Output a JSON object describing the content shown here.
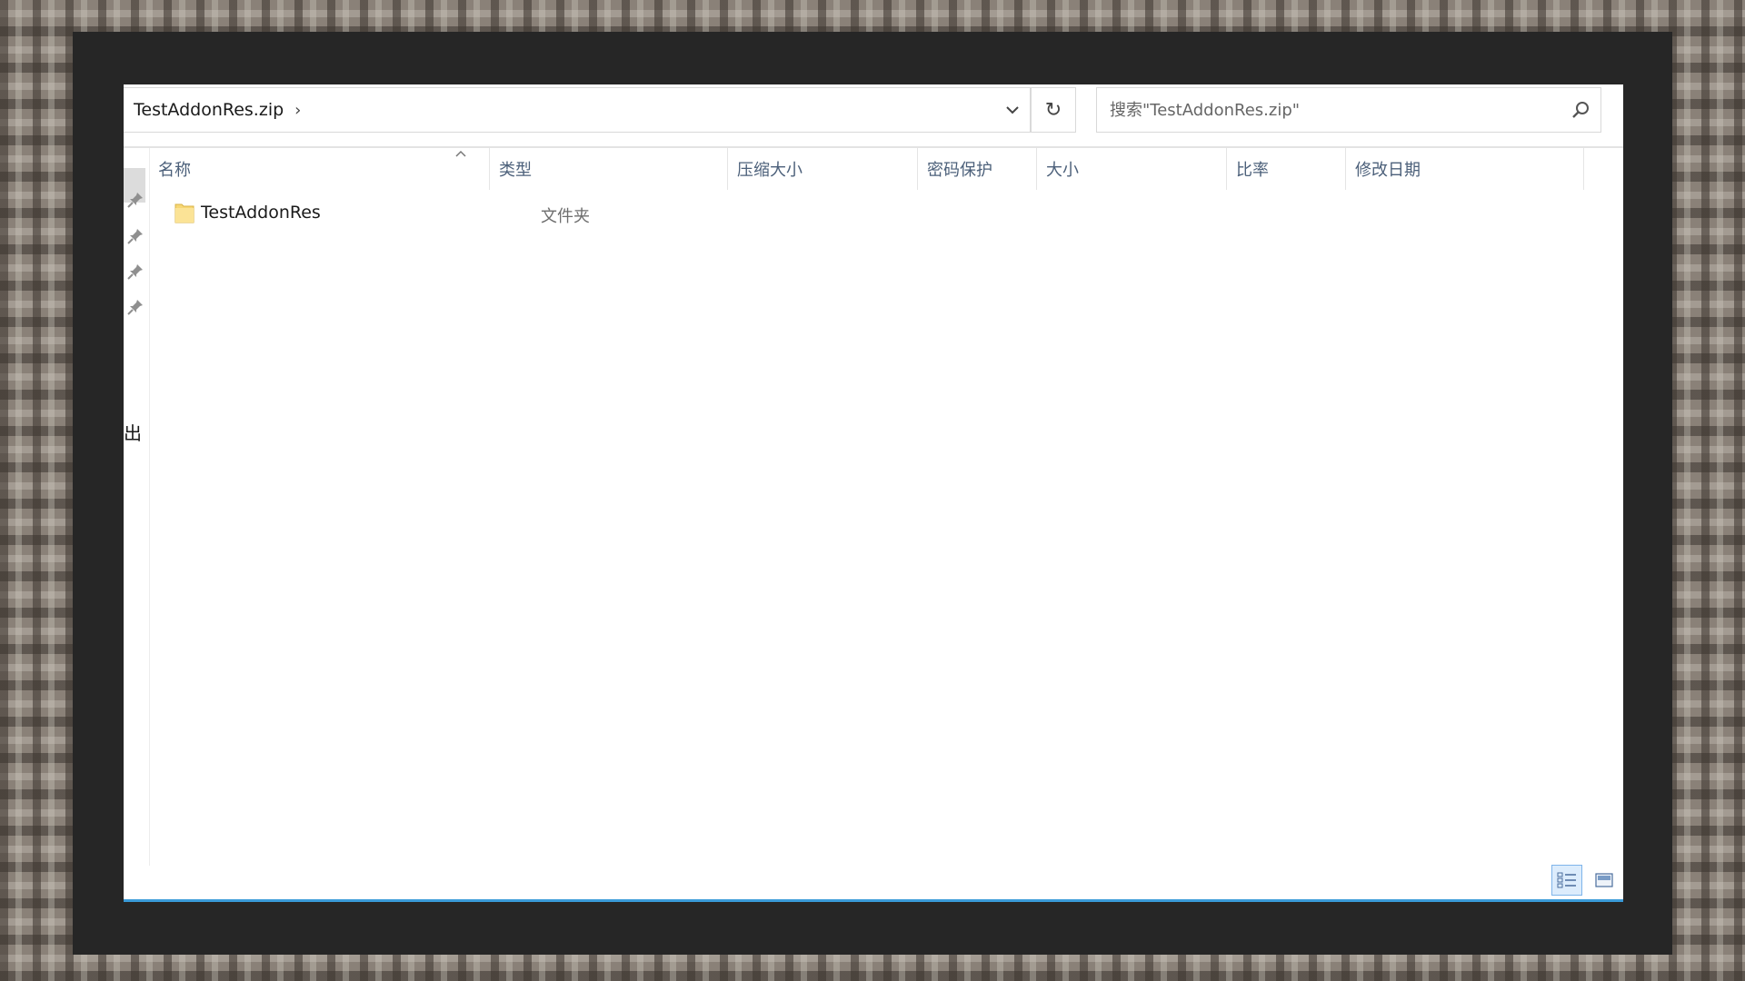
{
  "toolbar": {
    "breadcrumb": {
      "root": "TestAddonRes.zip",
      "separator": "›"
    },
    "refresh_glyph": "↻",
    "search": {
      "placeholder": "搜索\"TestAddonRes.zip\""
    }
  },
  "nav_pane": {
    "label": "出"
  },
  "columns": [
    {
      "label": "名称"
    },
    {
      "label": "类型"
    },
    {
      "label": "压缩大小"
    },
    {
      "label": "密码保护"
    },
    {
      "label": "大小"
    },
    {
      "label": "比率"
    },
    {
      "label": "修改日期"
    }
  ],
  "files": [
    {
      "name": "TestAddonRes",
      "type": "文件夹",
      "icon": "folder-icon"
    }
  ],
  "colors": {
    "accent": "#3a9bd9",
    "header_text": "#4c607a",
    "folder": "#f7d774"
  }
}
